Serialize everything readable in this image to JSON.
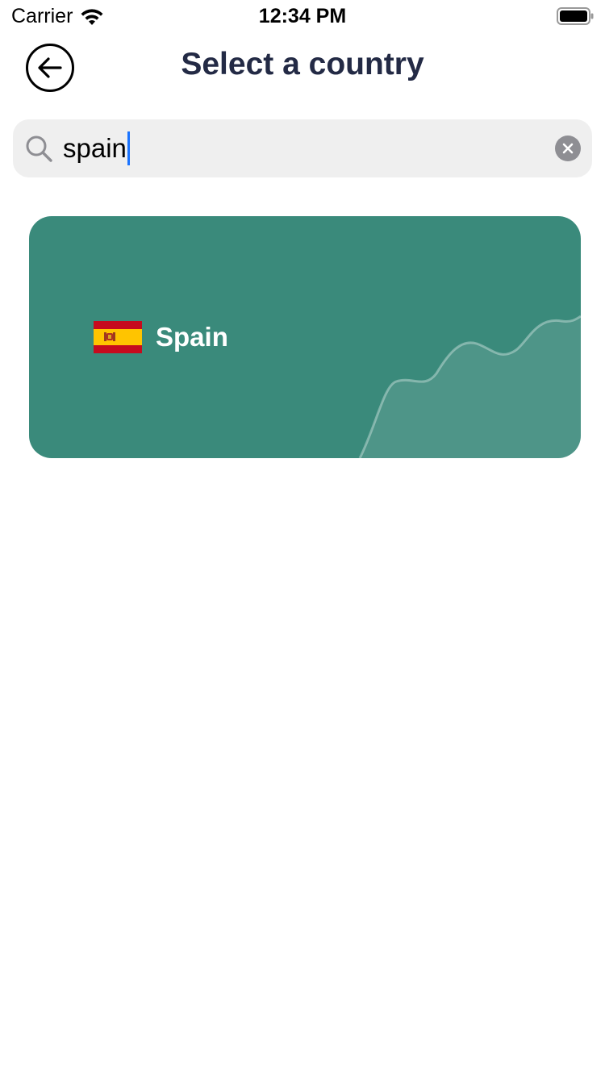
{
  "status_bar": {
    "carrier": "Carrier",
    "time": "12:34 PM",
    "icons": [
      "wifi-icon",
      "battery-icon"
    ]
  },
  "header": {
    "title": "Select a country",
    "back_icon": "arrow-left-icon"
  },
  "search": {
    "value": "spain",
    "icon": "search-icon",
    "clear_icon": "clear-icon"
  },
  "results": [
    {
      "country": "Spain",
      "flag": "spain-flag-icon"
    }
  ],
  "colors": {
    "card_background": "#3a8a7b",
    "title_color": "#232a45",
    "caret_color": "#1a73ff",
    "search_background": "#efefef"
  }
}
